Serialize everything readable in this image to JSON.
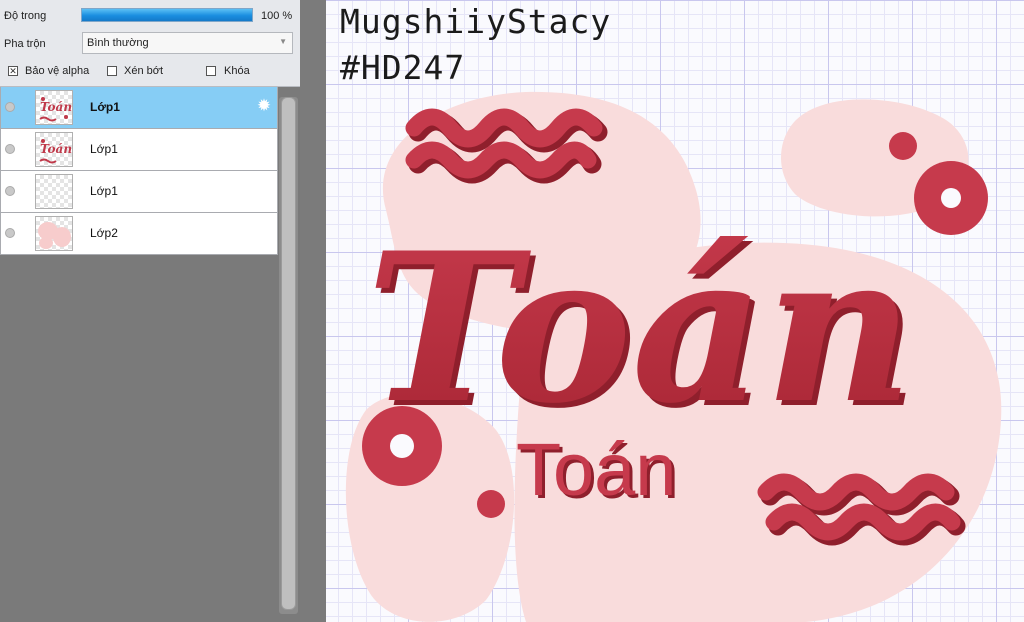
{
  "layer_props": {
    "opacity_label": "Độ trong",
    "opacity_value": "100 %",
    "opacity_fraction": 1.0,
    "blend_label": "Pha trộn",
    "blend_value": "Bình thường",
    "protect_alpha_label": "Bảo vệ alpha",
    "protect_alpha_checked": true,
    "clip_label": "Xén bớt",
    "clip_checked": false,
    "lock_label": "Khóa",
    "lock_checked": false
  },
  "layers": [
    {
      "name": "Lớp1",
      "selected": true,
      "thumb": "lettering"
    },
    {
      "name": "Lớp1",
      "selected": false,
      "thumb": "lettering"
    },
    {
      "name": "Lớp1",
      "selected": false,
      "thumb": "empty"
    },
    {
      "name": "Lớp2",
      "selected": false,
      "thumb": "blobs"
    }
  ],
  "icons": {
    "settings": "gear-icon",
    "visibility": "eye-icon",
    "dropdown": "chevron-down-icon"
  },
  "canvas": {
    "watermark_line1": "MugshiiyStacy",
    "watermark_line2": "#HD247",
    "title_text": "Toán",
    "subtitle_text": "Toán",
    "colors": {
      "lettering": "#bd2f41",
      "lettering_shadow": "#8f1f2c",
      "blob": "#f9dcdc",
      "grid_major": "#c9c7ee",
      "grid_minor": "#e6e5f7"
    }
  },
  "colors": {
    "selected_row": "#86cdf5",
    "opacity_bar": "#1a8ee0",
    "panel_bg": "#7a7a7a"
  }
}
